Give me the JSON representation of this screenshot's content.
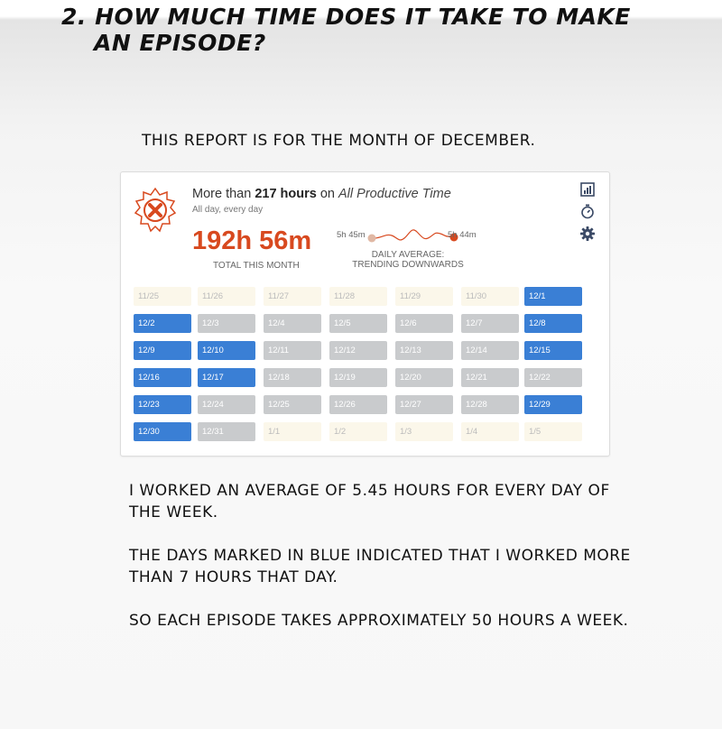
{
  "heading": {
    "line1": "2. How much time does it take to make",
    "line2": "an episode?"
  },
  "intro": "This report is for the month of December.",
  "report": {
    "goal_prefix": "More than ",
    "goal_hours": "217 hours",
    "goal_on": " on ",
    "goal_category": "All Productive Time",
    "goal_sub": "All day, every day",
    "total": "192h 56m",
    "total_label": "TOTAL THIS MONTH",
    "spark_start": "5h 45m",
    "spark_end": "5h 44m",
    "avg_line1": "DAILY AVERAGE:",
    "avg_line2": "TRENDING DOWNWARDS",
    "icons": [
      "bar-chart-icon",
      "stopwatch-icon",
      "gear-icon"
    ],
    "colors": {
      "accent": "#d8491f",
      "met": "#3a7fd5",
      "missed": "#c9cbcd",
      "outside": "#fbf7ea"
    },
    "calendar": [
      [
        {
          "d": "11/25",
          "s": "empty"
        },
        {
          "d": "11/26",
          "s": "empty"
        },
        {
          "d": "11/27",
          "s": "empty"
        },
        {
          "d": "11/28",
          "s": "empty"
        },
        {
          "d": "11/29",
          "s": "empty"
        },
        {
          "d": "11/30",
          "s": "empty"
        },
        {
          "d": "12/1",
          "s": "blue"
        }
      ],
      [
        {
          "d": "12/2",
          "s": "blue"
        },
        {
          "d": "12/3",
          "s": "gray"
        },
        {
          "d": "12/4",
          "s": "gray"
        },
        {
          "d": "12/5",
          "s": "gray"
        },
        {
          "d": "12/6",
          "s": "gray"
        },
        {
          "d": "12/7",
          "s": "gray"
        },
        {
          "d": "12/8",
          "s": "blue"
        }
      ],
      [
        {
          "d": "12/9",
          "s": "blue"
        },
        {
          "d": "12/10",
          "s": "blue"
        },
        {
          "d": "12/11",
          "s": "gray"
        },
        {
          "d": "12/12",
          "s": "gray"
        },
        {
          "d": "12/13",
          "s": "gray"
        },
        {
          "d": "12/14",
          "s": "gray"
        },
        {
          "d": "12/15",
          "s": "blue"
        }
      ],
      [
        {
          "d": "12/16",
          "s": "blue"
        },
        {
          "d": "12/17",
          "s": "blue"
        },
        {
          "d": "12/18",
          "s": "gray"
        },
        {
          "d": "12/19",
          "s": "gray"
        },
        {
          "d": "12/20",
          "s": "gray"
        },
        {
          "d": "12/21",
          "s": "gray"
        },
        {
          "d": "12/22",
          "s": "gray"
        }
      ],
      [
        {
          "d": "12/23",
          "s": "blue"
        },
        {
          "d": "12/24",
          "s": "gray"
        },
        {
          "d": "12/25",
          "s": "gray"
        },
        {
          "d": "12/26",
          "s": "gray"
        },
        {
          "d": "12/27",
          "s": "gray"
        },
        {
          "d": "12/28",
          "s": "gray"
        },
        {
          "d": "12/29",
          "s": "blue"
        }
      ],
      [
        {
          "d": "12/30",
          "s": "blue"
        },
        {
          "d": "12/31",
          "s": "gray"
        },
        {
          "d": "1/1",
          "s": "empty"
        },
        {
          "d": "1/2",
          "s": "empty"
        },
        {
          "d": "1/3",
          "s": "empty"
        },
        {
          "d": "1/4",
          "s": "empty"
        },
        {
          "d": "1/5",
          "s": "empty"
        }
      ]
    ]
  },
  "paragraphs": [
    "I worked an average of 5.45 hours for every day of the week.",
    "The days marked in blue indicated that I worked more than 7 hours that day.",
    "So each episode takes approximately 50 hours a week."
  ]
}
